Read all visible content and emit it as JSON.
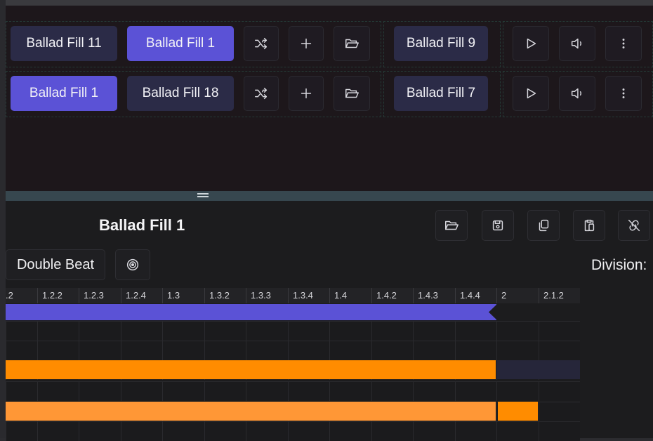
{
  "pads": {
    "row1": {
      "pad_a": "Ballad Fill 11",
      "pad_b": "Ballad Fill 1",
      "pad_c": "Ballad Fill 9"
    },
    "row2": {
      "pad_a": "Ballad Fill 1",
      "pad_b": "Ballad Fill 18",
      "pad_c": "Ballad Fill 7"
    }
  },
  "editor": {
    "title": "Ballad Fill 1",
    "mode_label": "Double Beat",
    "division_label": "Division:"
  },
  "ruler": {
    "ticks": [
      ".2",
      "1.2.2",
      "1.2.3",
      "1.2.4",
      "1.3",
      "1.3.2",
      "1.3.3",
      "1.3.4",
      "1.4",
      "1.4.2",
      "1.4.3",
      "1.4.4",
      "2",
      "2.1.2"
    ]
  },
  "colors": {
    "accent": "#5b52d6",
    "pad": "#2b2b47",
    "orange": "#ff8c00",
    "orange_light": "#ff9736",
    "background": "#1d171b"
  },
  "icons": {
    "shuffle": "shuffle-icon",
    "add": "plus-icon",
    "open": "folder-open-icon",
    "play": "play-icon",
    "volume": "volume-icon",
    "more": "more-vertical-icon",
    "save": "save-icon",
    "copy": "copy-icon",
    "paste": "paste-icon",
    "unlink": "unlink-icon",
    "target": "target-icon"
  }
}
